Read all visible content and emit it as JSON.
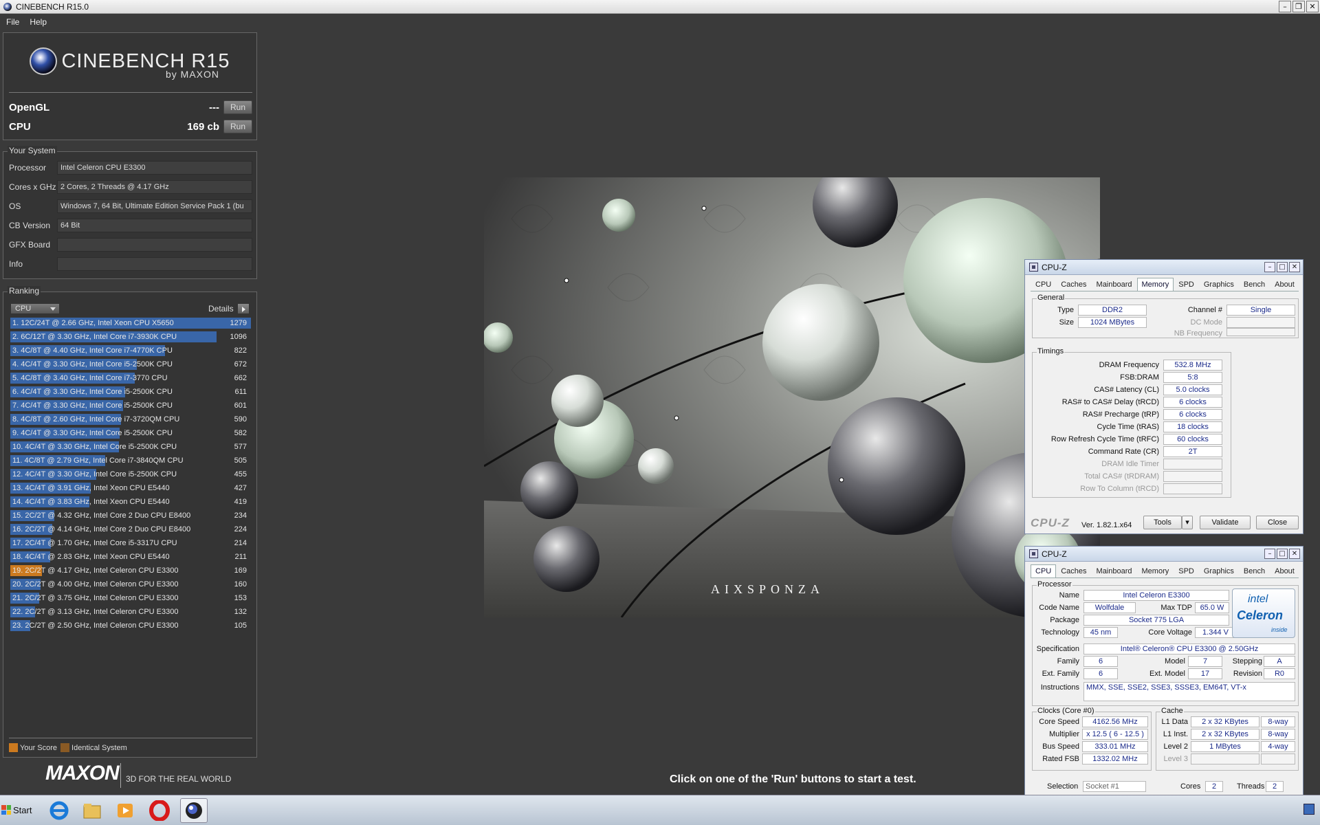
{
  "window": {
    "title": "CINEBENCH R15.0"
  },
  "menu": [
    "File",
    "Help"
  ],
  "logo": {
    "name": "CINEBENCH R15",
    "by": "by MAXON"
  },
  "scores": {
    "opengl_label": "OpenGL",
    "opengl_value": "---",
    "cpu_label": "CPU",
    "cpu_value": "169 cb",
    "run_label": "Run"
  },
  "system": {
    "title": "Your System",
    "rows": [
      {
        "k": "Processor",
        "v": "Intel Celeron CPU E3300"
      },
      {
        "k": "Cores x GHz",
        "v": "2 Cores, 2 Threads @ 4.17 GHz"
      },
      {
        "k": "OS",
        "v": "Windows 7, 64 Bit, Ultimate Edition Service Pack 1 (bu"
      },
      {
        "k": "CB Version",
        "v": "64 Bit"
      },
      {
        "k": "GFX Board",
        "v": ""
      },
      {
        "k": "Info",
        "v": ""
      }
    ]
  },
  "ranking": {
    "title": "Ranking",
    "select": "CPU",
    "details": "Details",
    "max": 1279,
    "rows": [
      {
        "label": "1. 12C/24T @ 2.66 GHz, Intel Xeon CPU X5650",
        "score": 1279,
        "mine": false
      },
      {
        "label": "2. 6C/12T @ 3.30 GHz,  Intel Core i7-3930K CPU",
        "score": 1096,
        "mine": false
      },
      {
        "label": "3. 4C/8T @ 4.40 GHz, Intel Core i7-4770K CPU",
        "score": 822,
        "mine": false
      },
      {
        "label": "4. 4C/4T @ 3.30 GHz,  Intel Core i5-2500K CPU",
        "score": 672,
        "mine": false
      },
      {
        "label": "5. 4C/8T @ 3.40 GHz,  Intel Core i7-3770 CPU",
        "score": 662,
        "mine": false
      },
      {
        "label": "6. 4C/4T @ 3.30 GHz,  Intel Core i5-2500K CPU",
        "score": 611,
        "mine": false
      },
      {
        "label": "7. 4C/4T @ 3.30 GHz,  Intel Core i5-2500K CPU",
        "score": 601,
        "mine": false
      },
      {
        "label": "8. 4C/8T @ 2.60 GHz, Intel Core i7-3720QM CPU",
        "score": 590,
        "mine": false
      },
      {
        "label": "9. 4C/4T @ 3.30 GHz,  Intel Core i5-2500K CPU",
        "score": 582,
        "mine": false
      },
      {
        "label": "10. 4C/4T @ 3.30 GHz,  Intel Core i5-2500K CPU",
        "score": 577,
        "mine": false
      },
      {
        "label": "11. 4C/8T @ 2.79 GHz,  Intel Core i7-3840QM CPU",
        "score": 505,
        "mine": false
      },
      {
        "label": "12. 4C/4T @ 3.30 GHz,  Intel Core i5-2500K CPU",
        "score": 455,
        "mine": false
      },
      {
        "label": "13. 4C/4T @ 3.91 GHz, Intel Xeon CPU E5440",
        "score": 427,
        "mine": false
      },
      {
        "label": "14. 4C/4T @ 3.83 GHz, Intel Xeon CPU E5440",
        "score": 419,
        "mine": false
      },
      {
        "label": "15. 2C/2T @ 4.32 GHz, Intel Core 2 Duo CPU E8400",
        "score": 234,
        "mine": false
      },
      {
        "label": "16. 2C/2T @ 4.14 GHz, Intel Core 2 Duo CPU E8400",
        "score": 224,
        "mine": false
      },
      {
        "label": "17. 2C/4T @ 1.70 GHz,  Intel Core i5-3317U CPU",
        "score": 214,
        "mine": false
      },
      {
        "label": "18. 4C/4T @ 2.83 GHz, Intel Xeon CPU E5440",
        "score": 211,
        "mine": false
      },
      {
        "label": "19. 2C/2T @ 4.17 GHz, Intel Celeron CPU E3300",
        "score": 169,
        "mine": true
      },
      {
        "label": "20. 2C/2T @ 4.00 GHz, Intel Celeron CPU E3300",
        "score": 160,
        "mine": false
      },
      {
        "label": "21. 2C/2T @ 3.75 GHz, Intel Celeron CPU E3300",
        "score": 153,
        "mine": false
      },
      {
        "label": "22. 2C/2T @ 3.13 GHz, Intel Celeron CPU E3300",
        "score": 132,
        "mine": false
      },
      {
        "label": "23. 2C/2T @ 2.50 GHz, Intel Celeron CPU E3300",
        "score": 105,
        "mine": false
      }
    ],
    "legend_your": "Your Score",
    "legend_identical": "Identical System"
  },
  "footer": {
    "brand": "MAXON",
    "tagline": "3D FOR THE REAL WORLD"
  },
  "render": {
    "watermark": "AIXSPONZA"
  },
  "hint": "Click on one of the 'Run' buttons to start a test.",
  "cpuz_common": {
    "title": "CPU-Z",
    "tabs": [
      "CPU",
      "Caches",
      "Mainboard",
      "Memory",
      "SPD",
      "Graphics",
      "Bench",
      "About"
    ],
    "logo": "CPU-Z",
    "version": "Ver. 1.82.1.x64",
    "tools": "Tools",
    "validate": "Validate",
    "close": "Close"
  },
  "memory": {
    "general_title": "General",
    "type_label": "Type",
    "type": "DDR2",
    "size_label": "Size",
    "size": "1024 MBytes",
    "channel_label": "Channel #",
    "channel": "Single",
    "dcmode_label": "DC Mode",
    "nbfreq_label": "NB Frequency",
    "timings_title": "Timings",
    "timings": [
      {
        "k": "DRAM Frequency",
        "v": "532.8 MHz",
        "dis": false
      },
      {
        "k": "FSB:DRAM",
        "v": "5:8",
        "dis": false
      },
      {
        "k": "CAS# Latency (CL)",
        "v": "5.0 clocks",
        "dis": false
      },
      {
        "k": "RAS# to CAS# Delay (tRCD)",
        "v": "6 clocks",
        "dis": false
      },
      {
        "k": "RAS# Precharge (tRP)",
        "v": "6 clocks",
        "dis": false
      },
      {
        "k": "Cycle Time (tRAS)",
        "v": "18 clocks",
        "dis": false
      },
      {
        "k": "Row Refresh Cycle Time (tRFC)",
        "v": "60 clocks",
        "dis": false
      },
      {
        "k": "Command Rate (CR)",
        "v": "2T",
        "dis": false
      },
      {
        "k": "DRAM Idle Timer",
        "v": "",
        "dis": true
      },
      {
        "k": "Total CAS# (tRDRAM)",
        "v": "",
        "dis": true
      },
      {
        "k": "Row To Column (tRCD)",
        "v": "",
        "dis": true
      }
    ]
  },
  "cpu": {
    "processor_title": "Processor",
    "name_label": "Name",
    "name": "Intel Celeron E3300",
    "codename_label": "Code Name",
    "codename": "Wolfdale",
    "maxtdp_label": "Max TDP",
    "maxtdp": "65.0 W",
    "package_label": "Package",
    "package": "Socket 775 LGA",
    "tech_label": "Technology",
    "tech": "45 nm",
    "voltage_label": "Core Voltage",
    "voltage": "1.344 V",
    "spec_label": "Specification",
    "spec": "Intel® Celeron® CPU     E3300  @ 2.50GHz",
    "family_label": "Family",
    "family": "6",
    "model_label": "Model",
    "model": "7",
    "stepping_label": "Stepping",
    "stepping": "A",
    "extfamily_label": "Ext. Family",
    "extfamily": "6",
    "extmodel_label": "Ext. Model",
    "extmodel": "17",
    "revision_label": "Revision",
    "revision": "R0",
    "instr_label": "Instructions",
    "instr": "MMX, SSE, SSE2, SSE3, SSSE3, EM64T, VT-x",
    "intel_line1": "intel",
    "intel_line2": "Celeron",
    "intel_line3": "inside",
    "clocks_title": "Clocks (Core #0)",
    "corespeed_label": "Core Speed",
    "corespeed": "4162.56 MHz",
    "multiplier_label": "Multiplier",
    "multiplier": "x 12.5 ( 6 - 12.5 )",
    "busspeed_label": "Bus Speed",
    "busspeed": "333.01 MHz",
    "ratedfsb_label": "Rated FSB",
    "ratedfsb": "1332.02 MHz",
    "cache_title": "Cache",
    "l1d_label": "L1 Data",
    "l1d": "2 x 32 KBytes",
    "l1d_way": "8-way",
    "l1i_label": "L1 Inst.",
    "l1i": "2 x 32 KBytes",
    "l1i_way": "8-way",
    "l2_label": "Level 2",
    "l2": "1 MBytes",
    "l2_way": "4-way",
    "l3_label": "Level 3",
    "selection_label": "Selection",
    "selection": "Socket #1",
    "cores_label": "Cores",
    "cores": "2",
    "threads_label": "Threads",
    "threads": "2"
  },
  "taskbar": {
    "start": "Start"
  }
}
